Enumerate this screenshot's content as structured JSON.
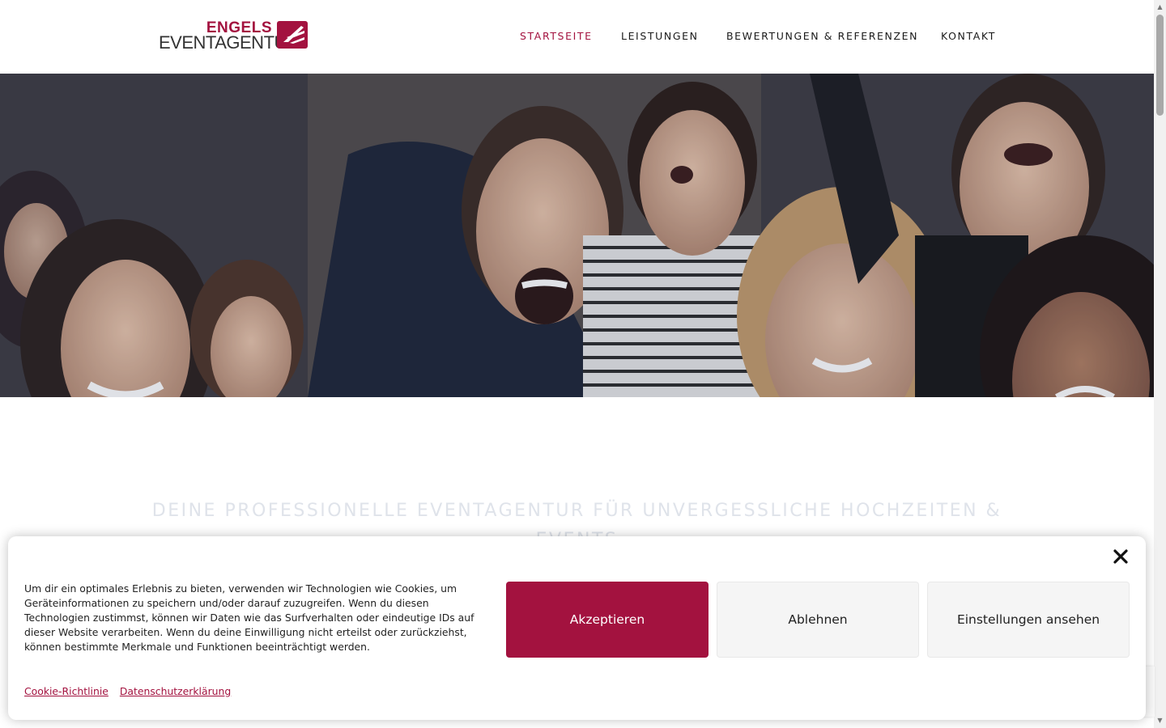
{
  "logo": {
    "line1": "ENGELS",
    "line2": "EVENTAGENTUR",
    "brand_color": "#a3123f"
  },
  "nav": {
    "items": [
      {
        "label": "STARTSEITE",
        "active": true
      },
      {
        "label": "LEISTUNGEN",
        "active": false
      },
      {
        "label": "BEWERTUNGEN & REFERENZEN",
        "active": false
      },
      {
        "label": "KONTAKT",
        "active": false
      }
    ]
  },
  "hero": {
    "image": "crowd-of-smiling-young-people-photo"
  },
  "main": {
    "headline": "DEINE PROFESSIONELLE EVENTAGENTUR FÜR UNVERGESSLICHE HOCHZEITEN & EVENTS"
  },
  "cookie_banner": {
    "text": "Um dir ein optimales Erlebnis zu bieten, verwenden wir Technologien wie Cookies, um Geräteinformationen zu speichern und/oder darauf zuzugreifen. Wenn du diesen Technologien zustimmst, können wir Daten wie das Surfverhalten oder eindeutige IDs auf dieser Website verarbeiten. Wenn du deine Einwilligung nicht erteilst oder zurückziehst, können bestimmte Merkmale und Funktionen beeinträchtigt werden.",
    "accept_label": "Akzeptieren",
    "deny_label": "Ablehnen",
    "settings_label": "Einstellungen ansehen",
    "links": [
      "Cookie-Richtlinie",
      "Datenschutzerklärung"
    ],
    "close_icon": "close-icon",
    "accent": "#a3123f"
  }
}
